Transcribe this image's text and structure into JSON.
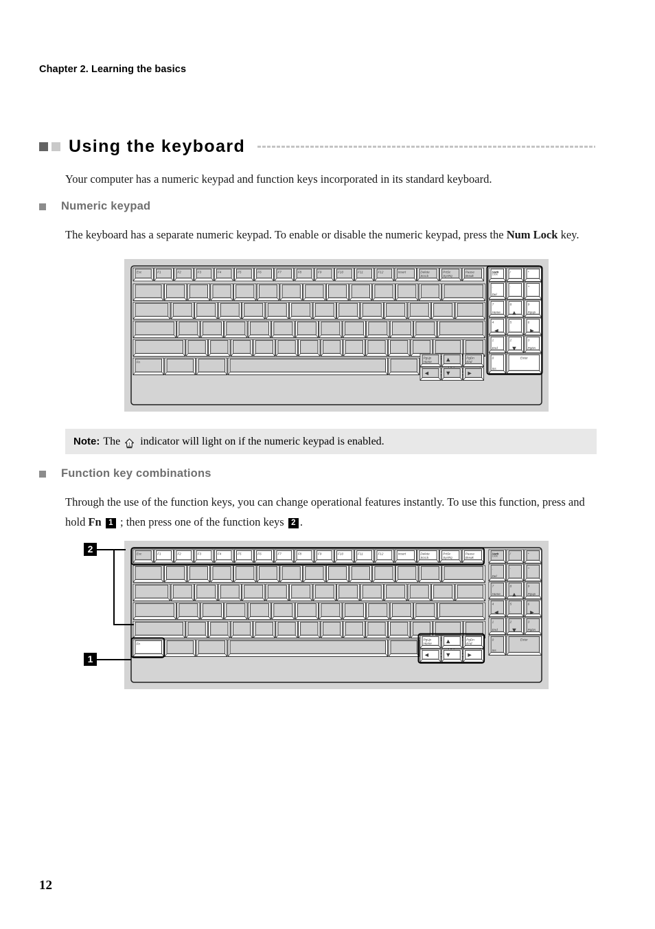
{
  "document": {
    "chapter_header": "Chapter 2. Learning the basics",
    "page_number": "12"
  },
  "section": {
    "title": "Using the keyboard",
    "intro": "Your computer has a numeric keypad and function keys incorporated in its standard keyboard."
  },
  "numeric_keypad": {
    "heading": "Numeric keypad",
    "body_part1": "The keyboard has a separate numeric keypad. To enable or disable the numeric keypad, press the ",
    "body_bold": "Num Lock",
    "body_part2": " key."
  },
  "note": {
    "label": "Note:",
    "text_before_icon": "The",
    "icon_name": "numeric-lock-indicator-icon",
    "text_after_icon": "indicator will light on if the numeric keypad is enabled."
  },
  "function_keys": {
    "heading": "Function key combinations",
    "body_part1": "Through the use of the function keys, you can change operational features instantly. To use this function, press and hold ",
    "body_bold_fn": "Fn",
    "marker_one": "1",
    "body_part2": "; then press one of the function keys",
    "marker_two": "2",
    "body_part3": "."
  },
  "callouts": {
    "label_one": "1",
    "label_two": "2",
    "target_one": "fn-key",
    "target_two": "function-key-row"
  },
  "colors": {
    "plate": "#d4d4d4",
    "key_gray": "#cfcfcf",
    "key_white": "#ffffff",
    "note_background": "#e8e8e8",
    "square_dark": "#636363",
    "square_light": "#c9c9c9",
    "subhead_text": "#6f6f6f",
    "rule": "#c4c4c4"
  },
  "keyboard_figure_1": {
    "caption_role": "numeric-keypad-highlighted",
    "highlight": "numpad",
    "function_row": [
      "Esc",
      "F1",
      "F2",
      "F3",
      "F4",
      "F5",
      "F6",
      "F7",
      "F8",
      "F9",
      "F10",
      "F11",
      "F12",
      "Insert",
      "Delete",
      "PrtSc",
      "Pause"
    ],
    "function_row_sub": [
      "",
      "",
      "",
      "",
      "",
      "",
      "",
      "",
      "",
      "",
      "",
      "",
      "",
      "",
      "ScrLk",
      "SysRq",
      "Break"
    ],
    "numpad_keys": [
      {
        "main": "Num",
        "main2": "Lock",
        "sub": ""
      },
      {
        "main": "/",
        "sub": ""
      },
      {
        "main": "*",
        "sub": ""
      },
      {
        "main": ".",
        "sub": "Del"
      },
      {
        "main": "-",
        "sub": ""
      },
      {
        "main": "+",
        "sub": ""
      },
      {
        "main": "7",
        "sub": "Home"
      },
      {
        "main": "8",
        "sub": "arrow-up"
      },
      {
        "main": "9",
        "sub": "PgUp"
      },
      {
        "main": "4",
        "sub": "arrow-left"
      },
      {
        "main": "5",
        "sub": "-"
      },
      {
        "main": "6",
        "sub": "arrow-right"
      },
      {
        "main": "1",
        "sub": "End"
      },
      {
        "main": "2",
        "sub": "arrow-down"
      },
      {
        "main": "3",
        "sub": "PgDn"
      },
      {
        "main": "0",
        "sub": "Ins"
      },
      {
        "main": "Enter",
        "sub": ""
      }
    ],
    "arrow_cluster": [
      {
        "main": "PgUp",
        "sub": "Home"
      },
      {
        "main": "arrow-up",
        "sub": ""
      },
      {
        "main": "PgDn",
        "sub": "End"
      },
      {
        "main": "arrow-left",
        "sub": ""
      },
      {
        "main": "arrow-down",
        "sub": ""
      },
      {
        "main": "arrow-right",
        "sub": ""
      }
    ],
    "fn_key": "Fn"
  },
  "keyboard_figure_2": {
    "caption_role": "function-keys-highlighted",
    "highlight": "function-row-fn-arrows",
    "function_row": [
      "Esc",
      "F1",
      "F2",
      "F3",
      "F4",
      "F5",
      "F6",
      "F7",
      "F8",
      "F9",
      "F10",
      "F11",
      "F12",
      "Insert",
      "Delete",
      "PrtSc",
      "Pause"
    ],
    "function_row_sub": [
      "",
      "",
      "",
      "",
      "",
      "",
      "",
      "",
      "",
      "",
      "",
      "",
      "",
      "",
      "ScrLk",
      "SysRq",
      "Break"
    ],
    "fn_key": "Fn",
    "numpad_keys": [
      {
        "main": "Num",
        "main2": "Lock"
      },
      {
        "main": "/"
      },
      {
        "main": "*"
      },
      {
        "main": ".",
        "sub": "Del"
      },
      {
        "main": "-"
      },
      {
        "main": "+"
      },
      {
        "main": "7",
        "sub": "Home"
      },
      {
        "main": "8",
        "sub": "arrow-up"
      },
      {
        "main": "9",
        "sub": "PgUp"
      },
      {
        "main": "4",
        "sub": "arrow-left"
      },
      {
        "main": "5",
        "sub": "-"
      },
      {
        "main": "6",
        "sub": "arrow-right"
      },
      {
        "main": "1",
        "sub": "End"
      },
      {
        "main": "2",
        "sub": "arrow-down"
      },
      {
        "main": "3",
        "sub": "PgDn"
      },
      {
        "main": "0",
        "sub": "Ins"
      },
      {
        "main": "Enter"
      }
    ],
    "arrow_cluster": [
      {
        "main": "PgUp",
        "sub": "Home"
      },
      {
        "main": "arrow-up",
        "sub": ""
      },
      {
        "main": "PgDn",
        "sub": "End"
      },
      {
        "main": "arrow-left",
        "sub": ""
      },
      {
        "main": "arrow-down",
        "sub": ""
      },
      {
        "main": "arrow-right",
        "sub": ""
      }
    ]
  }
}
